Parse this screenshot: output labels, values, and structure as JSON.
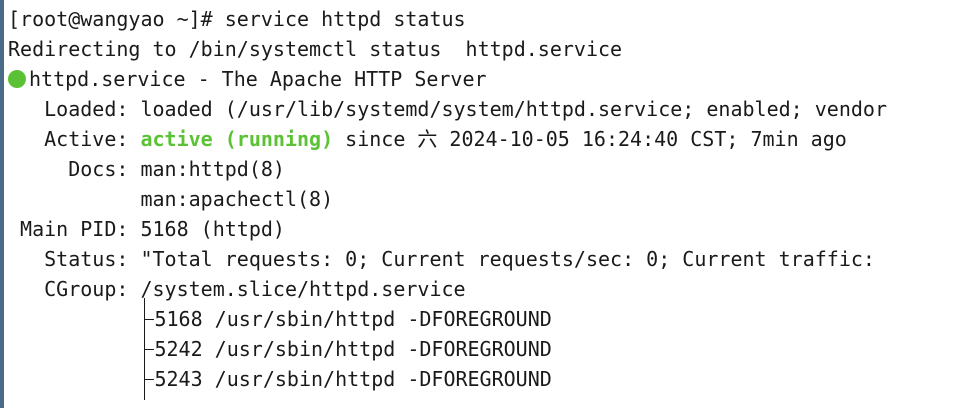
{
  "terminal": {
    "prompt": "[root@wangyao ~]# ",
    "command": "service httpd status",
    "redirect": "Redirecting to /bin/systemctl status  httpd.service",
    "unit_line": "httpd.service - The Apache HTTP Server",
    "loaded_label": "   Loaded: ",
    "loaded_value": "loaded (/usr/lib/systemd/system/httpd.service; enabled; vendor",
    "active_label": "   Active: ",
    "active_state": "active (running)",
    "active_rest": " since 六 2024-10-05 16:24:40 CST; 7min ago",
    "docs_label": "     Docs: ",
    "docs_1": "man:httpd(8)",
    "docs_2": "           man:apachectl(8)",
    "mainpid_label": " Main PID: ",
    "mainpid_value": "5168 (httpd)",
    "status_label": "   Status: ",
    "status_value": "\"Total requests: 0; Current requests/sec: 0; Current traffic:",
    "cgroup_label": "   CGroup: ",
    "cgroup_value": "/system.slice/httpd.service",
    "processes": [
      "5168 /usr/sbin/httpd -DFOREGROUND",
      "5242 /usr/sbin/httpd -DFOREGROUND",
      "5243 /usr/sbin/httpd -DFOREGROUND"
    ],
    "colors": {
      "active": "#5bc236",
      "status_dot": "#5bc236",
      "text": "#1a1a1a",
      "background": "#ffffff"
    },
    "icons": {
      "status_dot": "green-circle-icon"
    }
  }
}
